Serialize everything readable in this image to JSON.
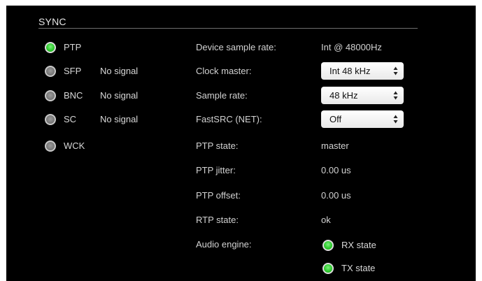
{
  "section": {
    "title": "SYNC"
  },
  "sources": [
    {
      "label": "PTP",
      "status": "",
      "active": true
    },
    {
      "label": "SFP",
      "status": "No signal",
      "active": false
    },
    {
      "label": "BNC",
      "status": "No signal",
      "active": false
    },
    {
      "label": "SC",
      "status": "No signal",
      "active": false
    },
    {
      "label": "WCK",
      "status": "",
      "active": false
    }
  ],
  "params": {
    "device_sample_rate": {
      "label": "Device sample rate:",
      "value": "Int @ 48000Hz"
    },
    "clock_master": {
      "label": "Clock master:",
      "value": "Int 48 kHz"
    },
    "sample_rate": {
      "label": "Sample rate:",
      "value": "48 kHz"
    },
    "fastsrc": {
      "label": "FastSRC (NET):",
      "value": "Off"
    },
    "ptp_state": {
      "label": "PTP state:",
      "value": "master"
    },
    "ptp_jitter": {
      "label": "PTP jitter:",
      "value": "0.00 us"
    },
    "ptp_offset": {
      "label": "PTP offset:",
      "value": "0.00 us"
    },
    "rtp_state": {
      "label": "RTP state:",
      "value": "ok"
    },
    "audio_engine": {
      "label": "Audio engine:",
      "rx_label": "RX state",
      "tx_label": "TX state",
      "rx_on": true,
      "tx_on": true
    }
  },
  "colors": {
    "background": "#000000",
    "led_active": "#2ecb2e",
    "led_inactive": "#7c7c7c",
    "text": "#d2d2d2"
  }
}
